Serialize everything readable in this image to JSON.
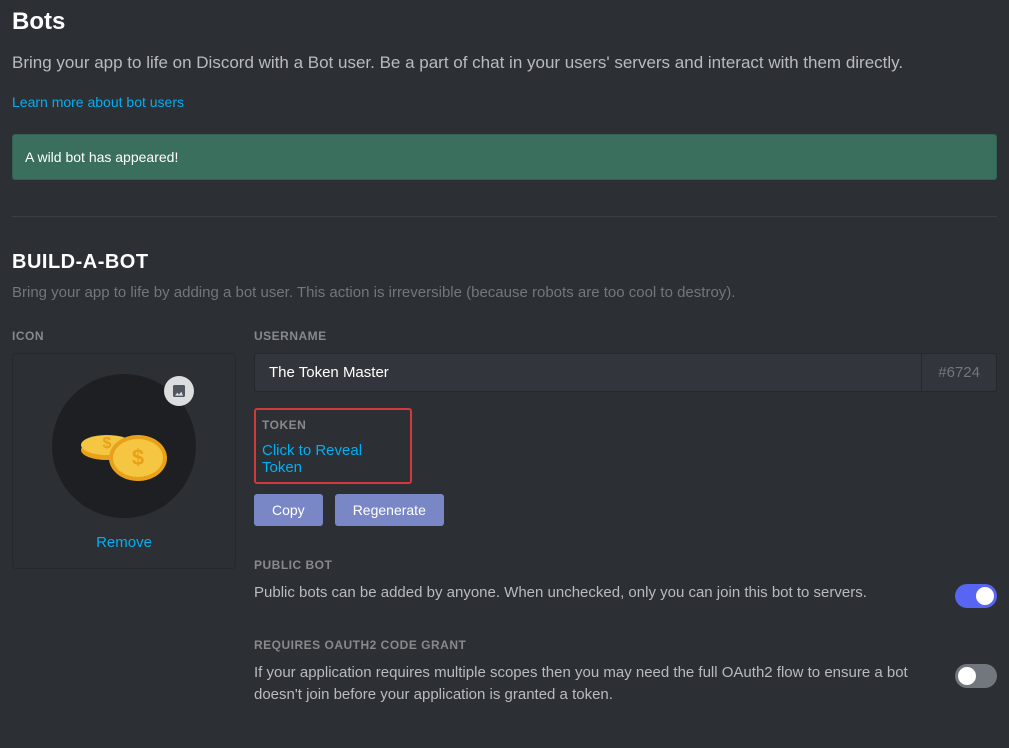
{
  "header": {
    "title": "Bots",
    "description": "Bring your app to life on Discord with a Bot user. Be a part of chat in your users' servers and interact with them directly.",
    "learn_more": "Learn more about bot users"
  },
  "banner": {
    "text": "A wild bot has appeared!"
  },
  "build": {
    "heading": "BUILD-A-BOT",
    "description": "Bring your app to life by adding a bot user. This action is irreversible (because robots are too cool to destroy).",
    "icon_label": "ICON",
    "remove_label": "Remove",
    "username_label": "USERNAME",
    "username_value": "The Token Master",
    "discriminator": "#6724",
    "token_label": "TOKEN",
    "reveal_label": "Click to Reveal Token",
    "copy_label": "Copy",
    "regenerate_label": "Regenerate"
  },
  "settings": {
    "public_bot": {
      "label": "PUBLIC BOT",
      "description": "Public bots can be added by anyone. When unchecked, only you can join this bot to servers.",
      "enabled": true
    },
    "oauth_grant": {
      "label": "REQUIRES OAUTH2 CODE GRANT",
      "description": "If your application requires multiple scopes then you may need the full OAuth2 flow to ensure a bot doesn't join before your application is granted a token.",
      "enabled": false
    }
  }
}
